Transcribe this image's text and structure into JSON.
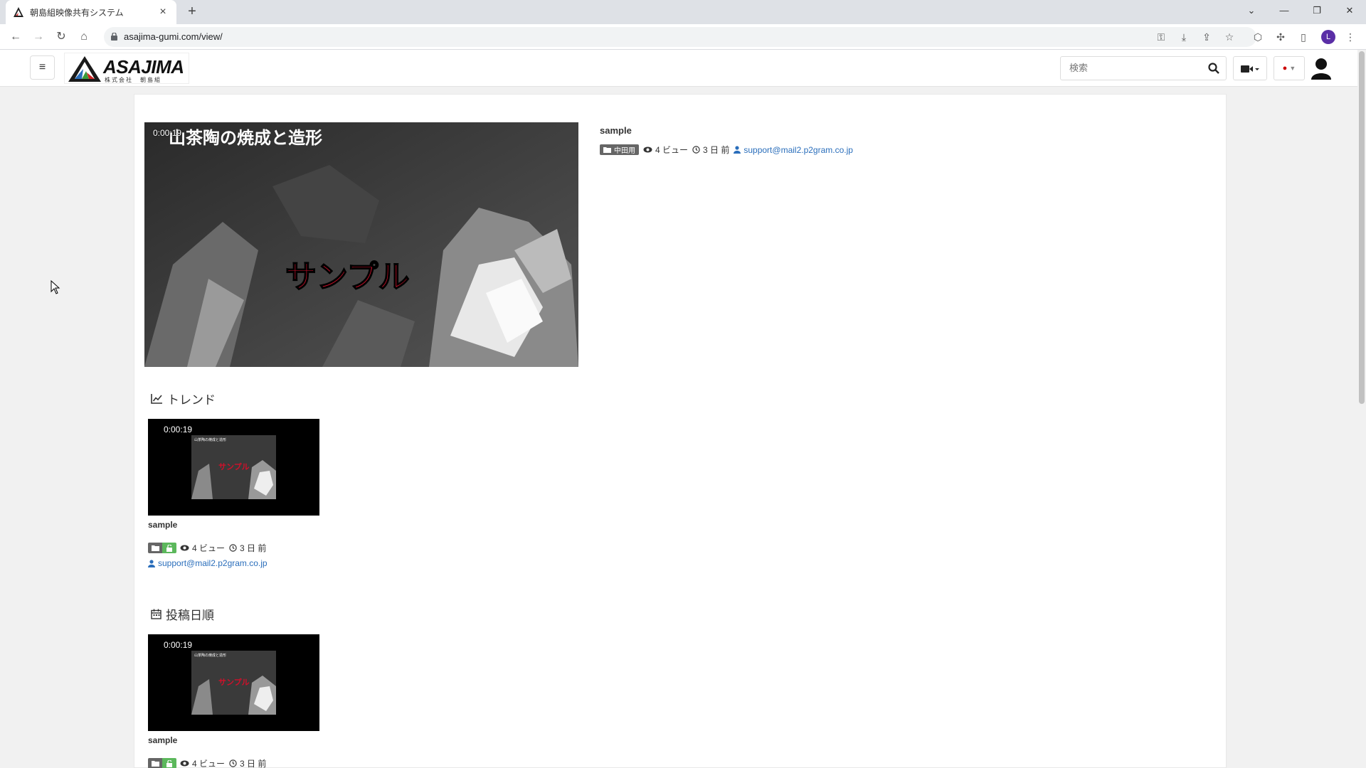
{
  "browser": {
    "tab_title": "朝島組映像共有システム",
    "url": "asajima-gumi.com/view/",
    "profile_initial": "L"
  },
  "site": {
    "logo_text": "ASAJIMA",
    "logo_sub": "株式会社　朝島組",
    "search_placeholder": "検索",
    "colors": {
      "accent_green": "#5cb85c",
      "link_blue": "#2a6ebb",
      "badge_gray": "#666666"
    }
  },
  "featured": {
    "duration": "0:00:19",
    "title": "sample",
    "category": "中田用",
    "views": "4 ビュー",
    "age": "3 日 前",
    "author": "support@mail2.p2gram.co.jp"
  },
  "sections": {
    "trend": {
      "heading": "トレンド",
      "card": {
        "duration": "0:00:19",
        "title": "sample",
        "views": "4 ビュー",
        "age": "3 日 前",
        "author": "support@mail2.p2gram.co.jp"
      }
    },
    "recent": {
      "heading": "投稿日順",
      "card": {
        "duration": "0:00:19",
        "title": "sample",
        "views": "4 ビュー",
        "age": "3 日 前"
      }
    }
  }
}
